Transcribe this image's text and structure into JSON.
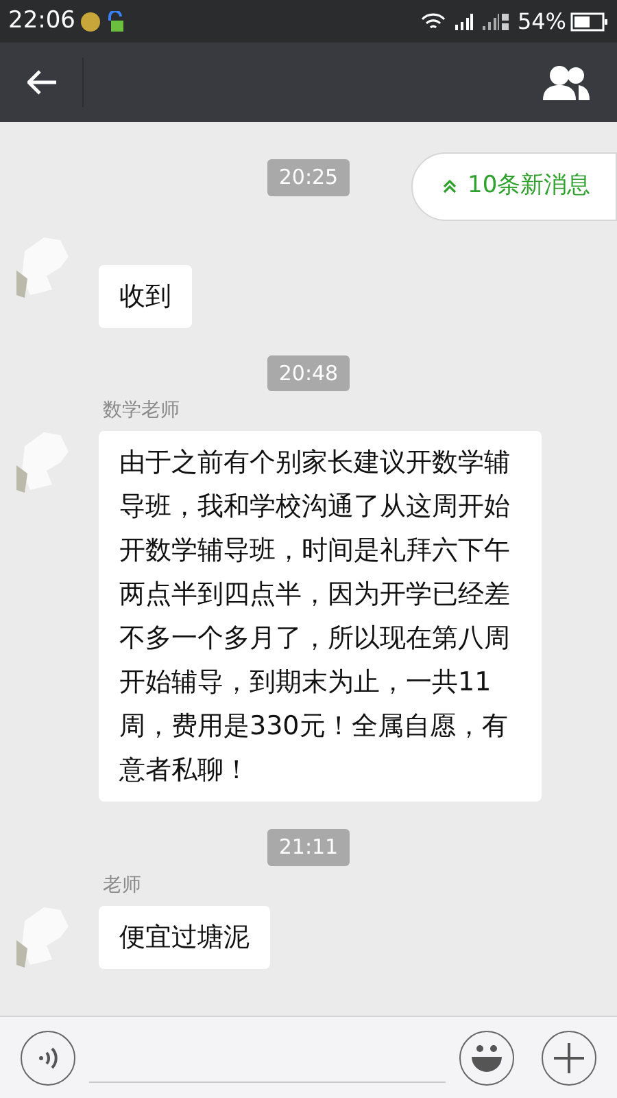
{
  "status_bar": {
    "time": "22:06",
    "battery": "54%"
  },
  "new_messages_badge": {
    "label": "10条新消息"
  },
  "messages": [
    {
      "kind": "time",
      "text": "20:25"
    },
    {
      "kind": "message",
      "text": "收到"
    },
    {
      "kind": "time",
      "text": "20:48"
    },
    {
      "kind": "message",
      "sender": "数学老师",
      "text": "由于之前有个别家长建议开数学辅导班，我和学校沟通了从这周开始开数学辅导班，时间是礼拜六下午两点半到四点半，因为开学已经差不多一个多月了，所以现在第八周开始辅导，到期末为止，一共11周，费用是330元！全属自愿，有意者私聊！"
    },
    {
      "kind": "time",
      "text": "21:11"
    },
    {
      "kind": "message",
      "sender": "老师",
      "text": "便宜过塘泥"
    }
  ]
}
